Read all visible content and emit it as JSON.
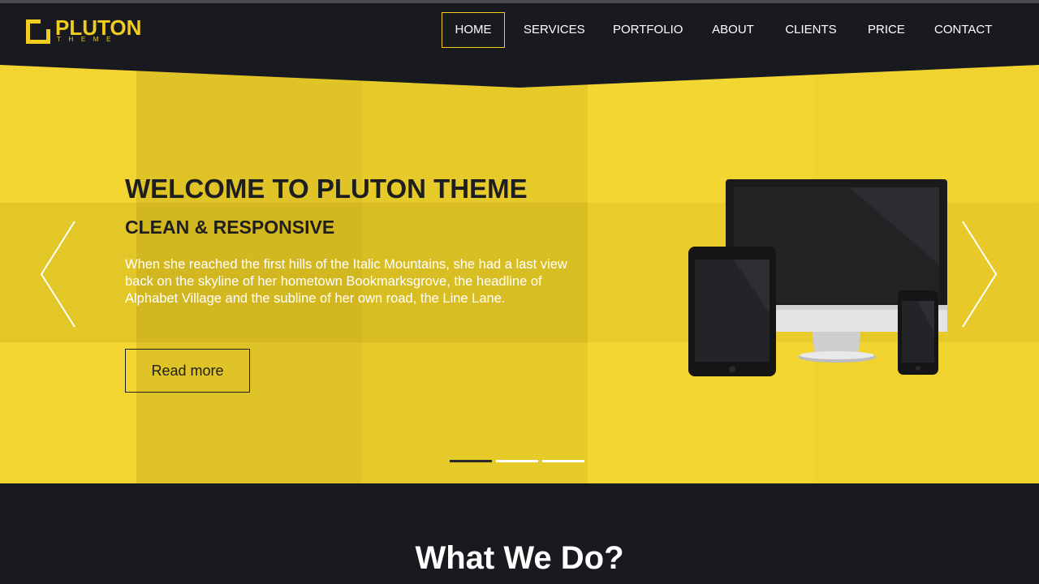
{
  "brand": {
    "name": "PLUTON",
    "tagline": "THEME",
    "accent_color": "#f2cc1e"
  },
  "nav": {
    "items": [
      {
        "label": "HOME",
        "active": true
      },
      {
        "label": "SERVICES",
        "active": false
      },
      {
        "label": "PORTFOLIO",
        "active": false
      },
      {
        "label": "ABOUT",
        "active": false
      },
      {
        "label": "CLIENTS",
        "active": false
      },
      {
        "label": "PRICE",
        "active": false
      },
      {
        "label": "CONTACT",
        "active": false
      }
    ]
  },
  "hero": {
    "title": "WELCOME TO PLUTON THEME",
    "subtitle": "CLEAN & RESPONSIVE",
    "text": "When she reached the first hills of the Italic Mountains, she had a last view back on the skyline of her hometown Bookmarksgrove, the headline of Alphabet Village and the subline of her own road, the Line Lane.",
    "button_label": "Read more",
    "background_color": "#f2d530",
    "prev_icon": "chevron-left-icon",
    "next_icon": "chevron-right-icon",
    "slides": {
      "count": 3,
      "active_index": 0
    },
    "image": "responsive-devices-illustration"
  },
  "section": {
    "title": "What We Do?"
  }
}
